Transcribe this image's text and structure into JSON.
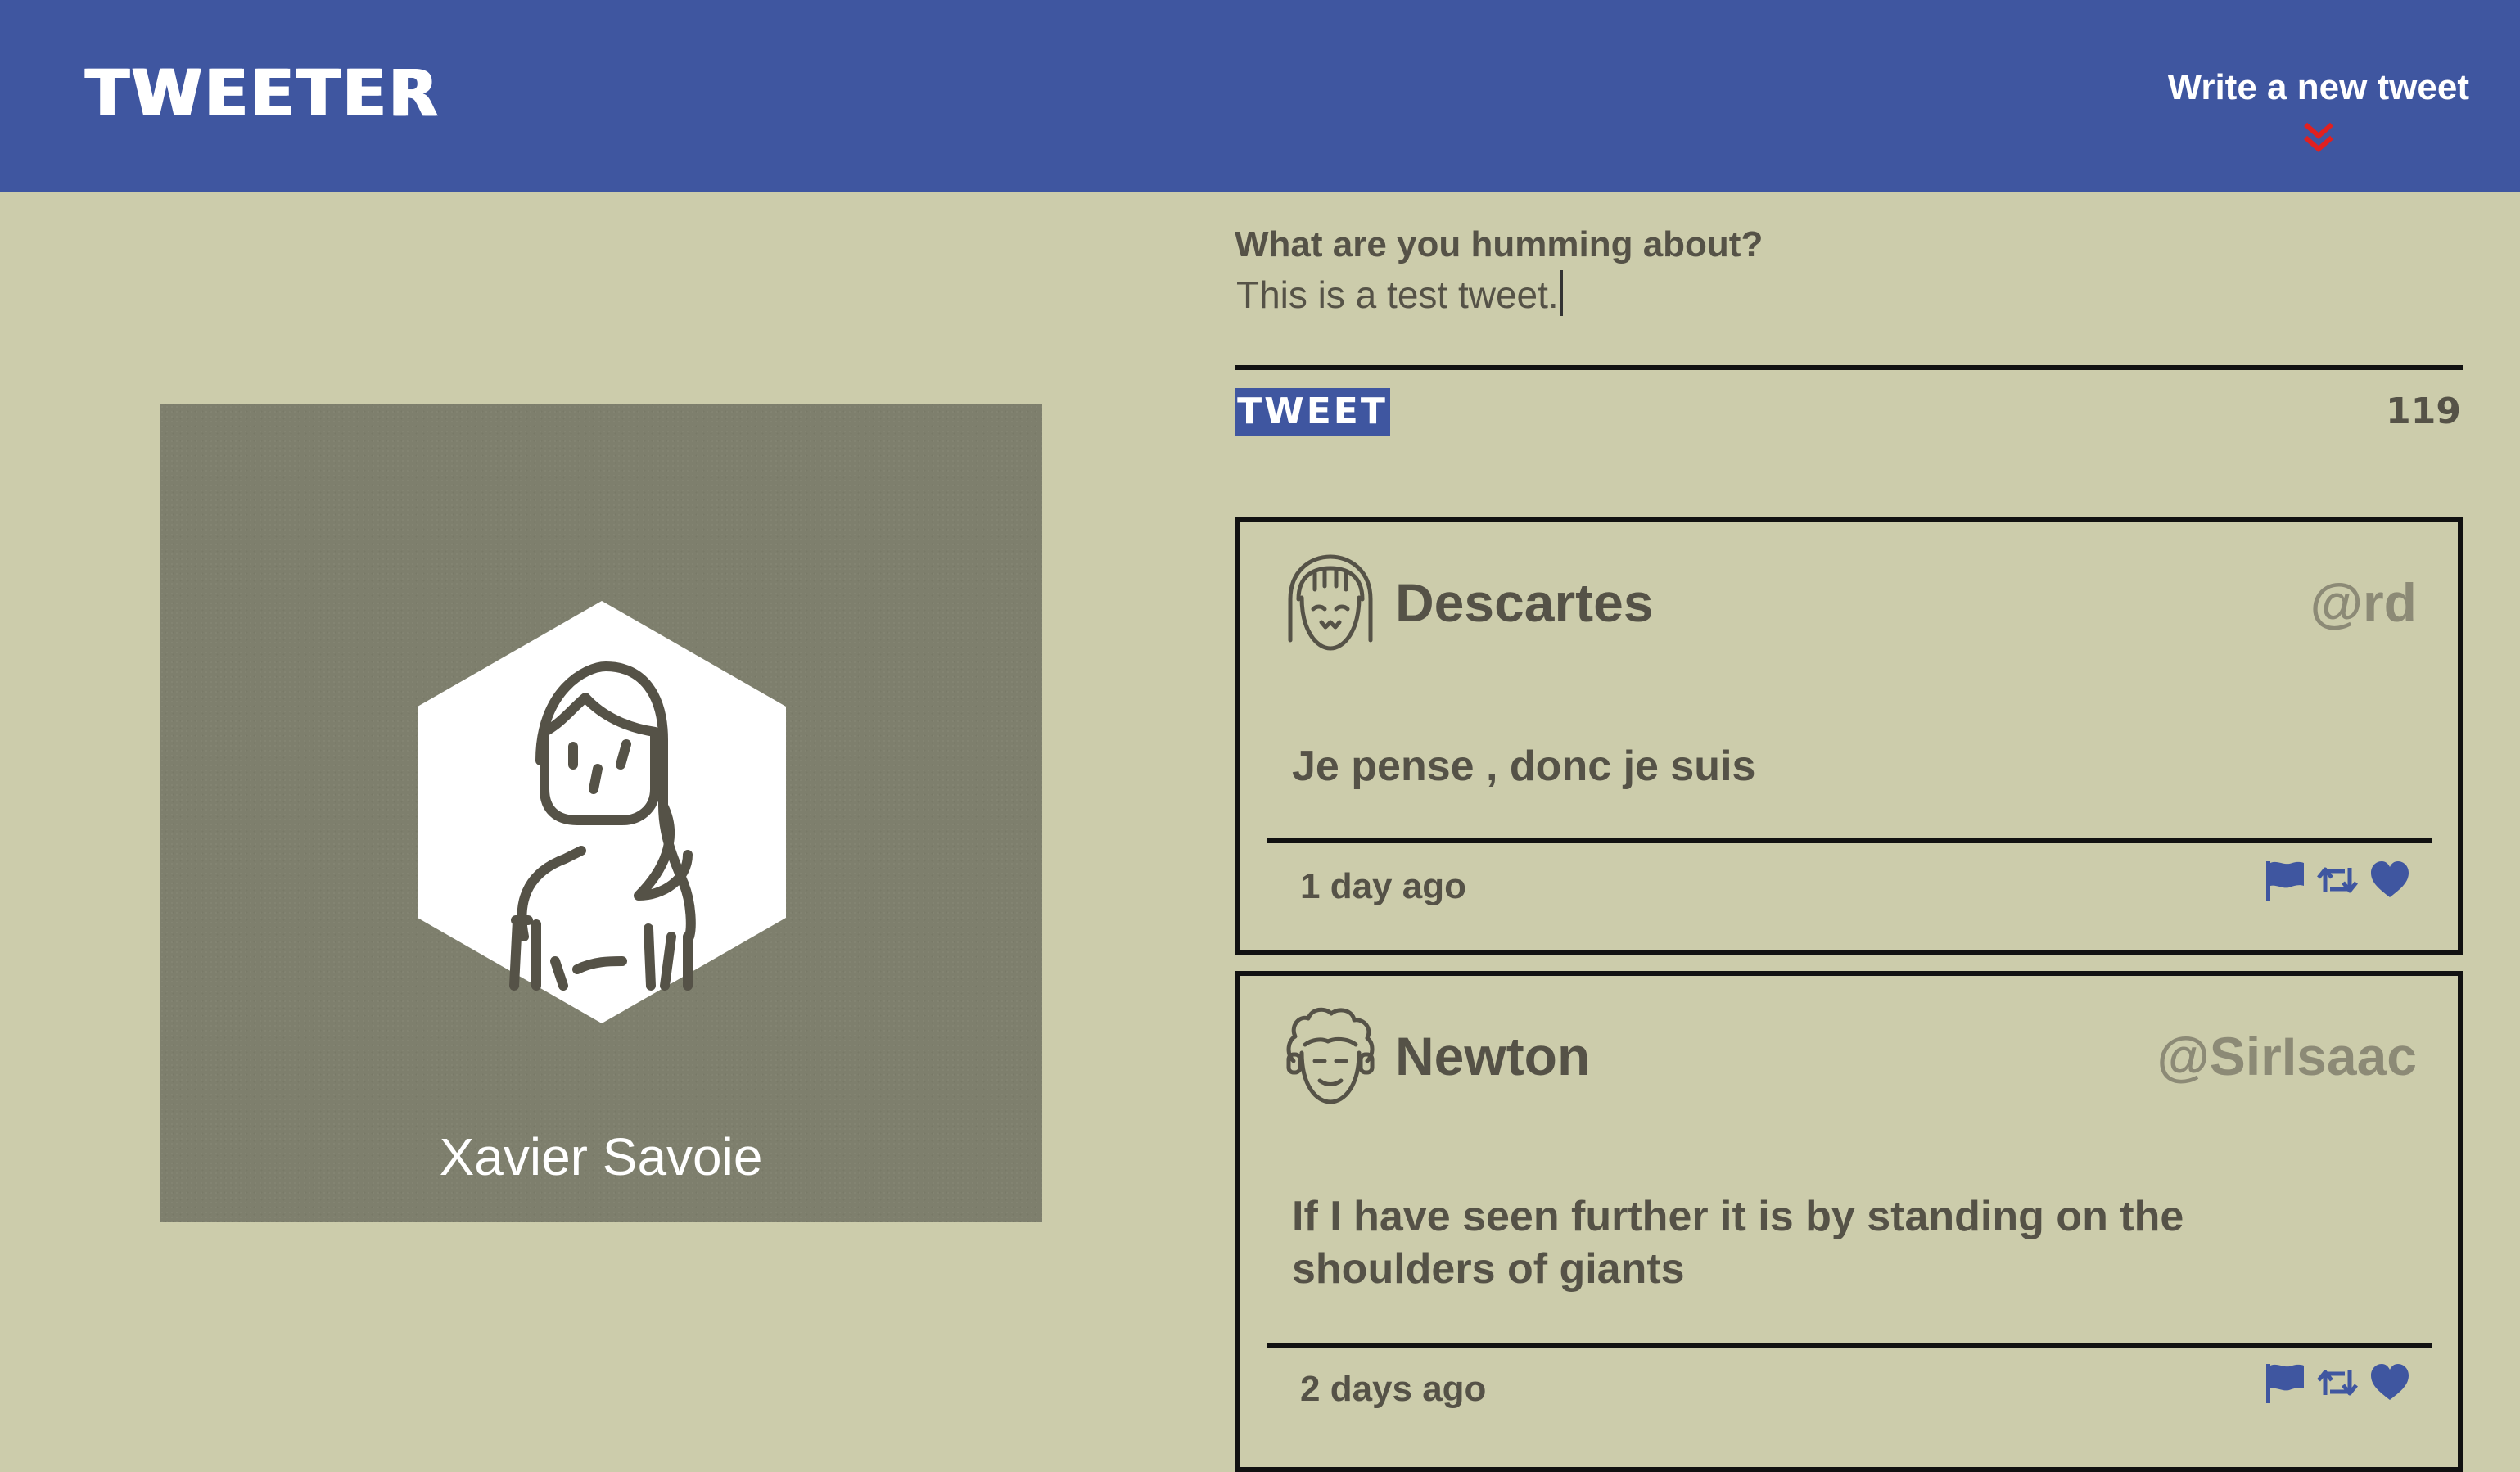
{
  "header": {
    "brand": "TWEETER",
    "compose_link": "Write a new tweet",
    "compose_icon": "chevron-double-down-icon",
    "brand_color": "#3f56a0",
    "accent_color": "#e02020"
  },
  "profile": {
    "name": "Xavier Savoie",
    "avatar_icon": "hexagon-avatar-icon"
  },
  "compose": {
    "prompt": "What are you humming about?",
    "value": "This is a test tweet.",
    "button_label": "TWEET",
    "char_count": "119"
  },
  "tweets": [
    {
      "author": "Descartes",
      "handle": "@rd",
      "avatar_icon": "girl-face-avatar-icon",
      "text": "Je pense , donc je suis",
      "time": "1 day ago",
      "actions": [
        "flag-icon",
        "retweet-icon",
        "heart-icon"
      ]
    },
    {
      "author": "Newton",
      "handle": "@SirIsaac",
      "avatar_icon": "curly-hair-face-avatar-icon",
      "text": "If I have seen further it is by standing on the shoulders of giants",
      "time": "2 days ago",
      "actions": [
        "flag-icon",
        "retweet-icon",
        "heart-icon"
      ]
    }
  ],
  "colors": {
    "background": "#ccccab",
    "card": "#7e7f6d",
    "text": "#555247",
    "handle": "#8c8a76",
    "icon_blue": "#3f56a0"
  }
}
